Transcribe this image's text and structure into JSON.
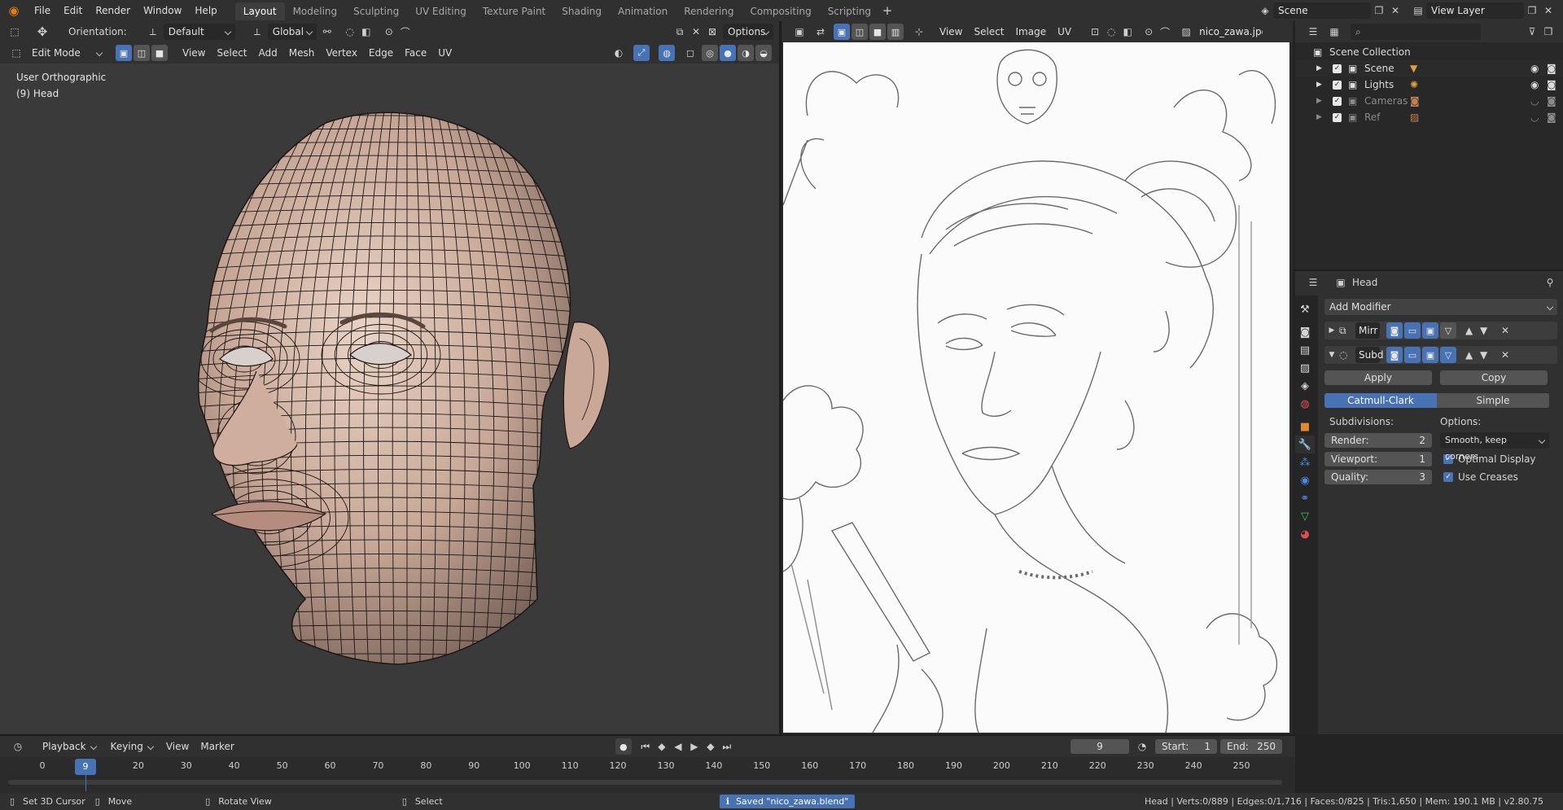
{
  "topbar": {
    "menus": [
      "File",
      "Edit",
      "Render",
      "Window",
      "Help"
    ],
    "workspaces": [
      "Layout",
      "Modeling",
      "Sculpting",
      "UV Editing",
      "Texture Paint",
      "Shading",
      "Animation",
      "Rendering",
      "Compositing",
      "Scripting"
    ],
    "active_workspace": "Layout",
    "scene": "Scene",
    "view_layer": "View Layer"
  },
  "viewport": {
    "orientation_label": "Orientation:",
    "orientation_value": "Default",
    "transform_space": "Global",
    "options_label": "Options",
    "mode": "Edit Mode",
    "menus": [
      "View",
      "Select",
      "Add",
      "Mesh",
      "Vertex",
      "Edge",
      "Face",
      "UV"
    ],
    "overlay_view": "User Orthographic",
    "overlay_object": "(9) Head"
  },
  "image_editor": {
    "menus": [
      "View",
      "Select",
      "Image",
      "UV"
    ],
    "image_name": "nico_zawa.jpg"
  },
  "outliner": {
    "root": "Scene Collection",
    "items": [
      {
        "label": "Scene",
        "dim": false
      },
      {
        "label": "Lights",
        "dim": false
      },
      {
        "label": "Cameras",
        "dim": true
      },
      {
        "label": "Ref",
        "dim": true
      }
    ]
  },
  "properties": {
    "object_name": "Head",
    "add_modifier": "Add Modifier",
    "modifiers": [
      {
        "name": "Mirr",
        "expanded": false
      },
      {
        "name": "Subd",
        "expanded": true
      }
    ],
    "apply_label": "Apply",
    "copy_label": "Copy",
    "type_options": [
      "Catmull-Clark",
      "Simple"
    ],
    "active_type": "Catmull-Clark",
    "subdivisions_label": "Subdivisions:",
    "options_label": "Options:",
    "render_label": "Render:",
    "render_value": "2",
    "viewport_label": "Viewport:",
    "viewport_value": "1",
    "quality_label": "Quality:",
    "quality_value": "3",
    "uv_smooth": "Smooth, keep corners",
    "optimal_display": "Optimal Display",
    "use_creases": "Use Creases"
  },
  "timeline": {
    "menus": [
      "Playback",
      "Keying",
      "View",
      "Marker"
    ],
    "current_frame": "9",
    "start_label": "Start:",
    "start_value": "1",
    "end_label": "End:",
    "end_value": "250",
    "ruler": [
      0,
      10,
      20,
      30,
      40,
      50,
      60,
      70,
      80,
      90,
      100,
      110,
      120,
      130,
      140,
      150,
      160,
      170,
      180,
      190,
      200,
      210,
      220,
      230,
      240,
      250
    ]
  },
  "statusbar": {
    "set_cursor": "Set 3D Cursor",
    "move": "Move",
    "rotate": "Rotate View",
    "select": "Select",
    "message": "Saved \"nico_zawa.blend\"",
    "stats": "Head | Verts:0/889 | Edges:0/1,716 | Faces:0/825 | Tris:1,650 | Mem: 190.1 MB | v2.80.75"
  },
  "colors": {
    "accent": "#4772b3",
    "header": "#303030",
    "viewport_bg": "#3a3a3a",
    "skin": "#c7a797"
  }
}
